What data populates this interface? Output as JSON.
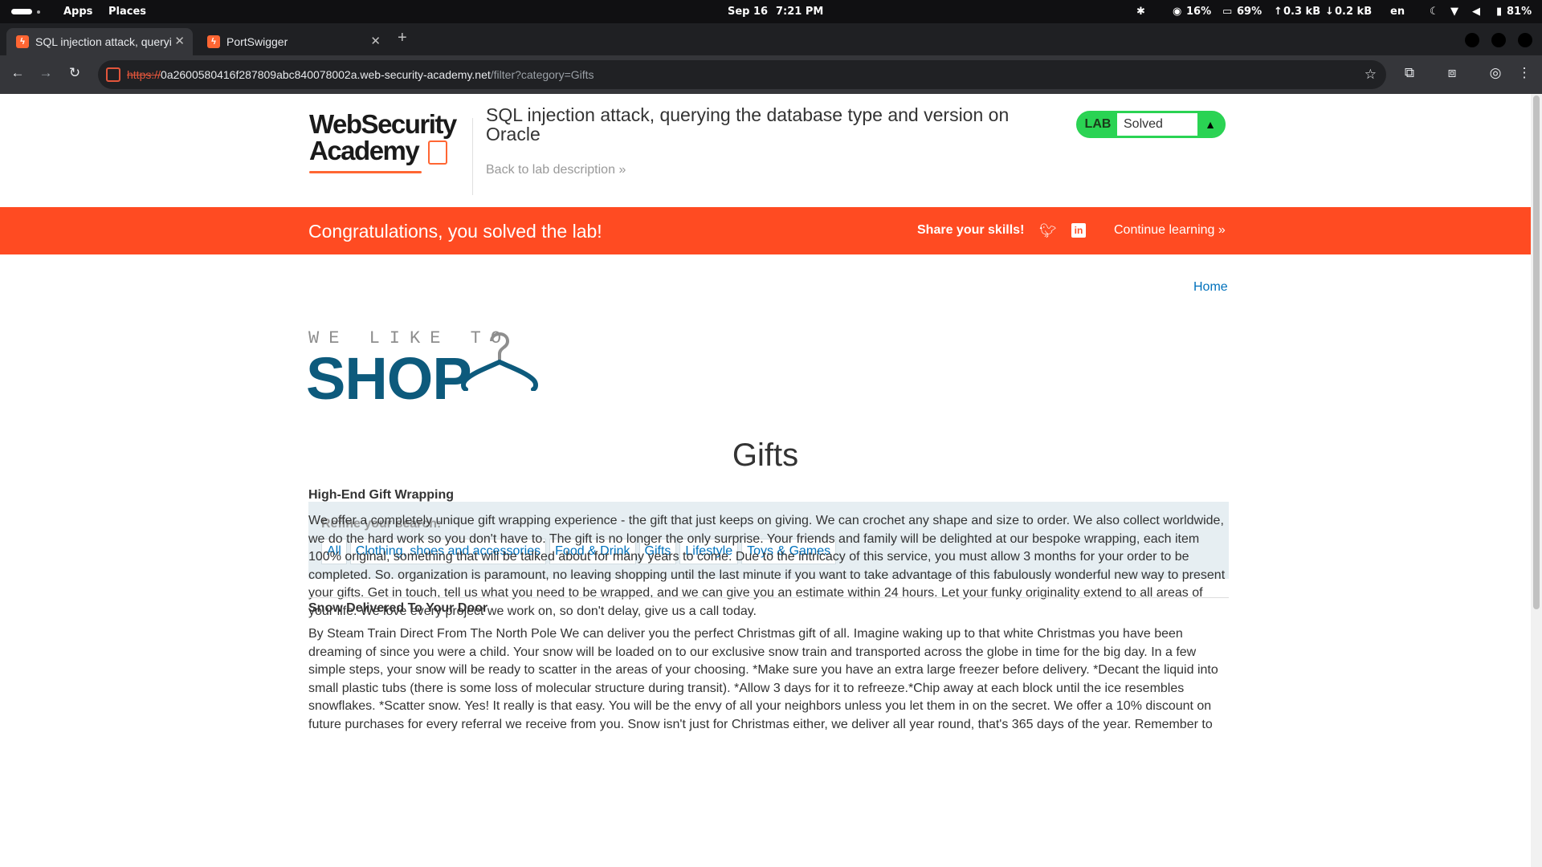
{
  "os_bar": {
    "apps": "Apps",
    "places": "Places",
    "date": "Sep 16",
    "time": "7:21 PM",
    "cpu": "16%",
    "memory": "69%",
    "upload": "0.3 kB",
    "download": "0.2 kB",
    "language": "en",
    "battery": "81%"
  },
  "browser": {
    "tabs": [
      {
        "title": "SQL injection attack, querying",
        "active": true
      },
      {
        "title": "PortSwigger",
        "active": false
      }
    ],
    "url": {
      "scheme": "https://",
      "host": "0a2600580416f287809abc840078002a.web-security-academy.net",
      "path": "/filter?category=Gifts"
    }
  },
  "header": {
    "logo_line1": "WebSecurity",
    "logo_line2": "Academy",
    "lab_title": "SQL injection attack, querying the database type and version on Oracle",
    "back_link": "Back to lab description",
    "lab_badge_label": "LAB",
    "lab_status": "Solved"
  },
  "banner": {
    "message": "Congratulations, you solved the lab!",
    "share": "Share your skills!",
    "continue": "Continue learning",
    "color": "#ff4b22"
  },
  "nav": {
    "home": "Home"
  },
  "shop_logo": {
    "tagline": "WE LIKE TO",
    "word": "SHOP"
  },
  "category_title": "Gifts",
  "filter": {
    "label": "Refine your search:",
    "links": [
      "All",
      "Clothing, shoes and accessories",
      "Food & Drink",
      "Gifts",
      "Lifestyle",
      "Toys & Games"
    ]
  },
  "products": [
    {
      "name": "High-End Gift Wrapping",
      "description": "We offer a completely unique gift wrapping experience - the gift that just keeps on giving. We can crochet any shape and size to order. We also collect worldwide, we do the hard work so you don't have to. The gift is no longer the only surprise. Your friends and family will be delighted at our bespoke wrapping, each item 100% original, something that will be talked about for many years to come. Due to the intricacy of this service, you must allow 3 months for your order to be completed. So. organization is paramount, no leaving shopping until the last minute if you want to take advantage of this fabulously wonderful new way to present your gifts. Get in touch, tell us what you need to be wrapped, and we can give you an estimate within 24 hours. Let your funky originality extend to all areas of your life. We love every project we work on, so don't delay, give us a call today."
    },
    {
      "name": "Snow Delivered To Your Door",
      "description": "By Steam Train Direct From The North Pole We can deliver you the perfect Christmas gift of all. Imagine waking up to that white Christmas you have been dreaming of since you were a child. Your snow will be loaded on to our exclusive snow train and transported across the globe in time for the big day. In a few simple steps, your snow will be ready to scatter in the areas of your choosing. *Make sure you have an extra large freezer before delivery. *Decant the liquid into small plastic tubs (there is some loss of molecular structure during transit). *Allow 3 days for it to refreeze.*Chip away at each block until the ice resembles snowflakes. *Scatter snow. Yes! It really is that easy. You will be the envy of all your neighbors unless you let them in on the secret. We offer a 10% discount on future purchases for every referral we receive from you. Snow isn't just for Christmas either, we deliver all year round, that's 365 days of the year. Remember to"
    }
  ]
}
